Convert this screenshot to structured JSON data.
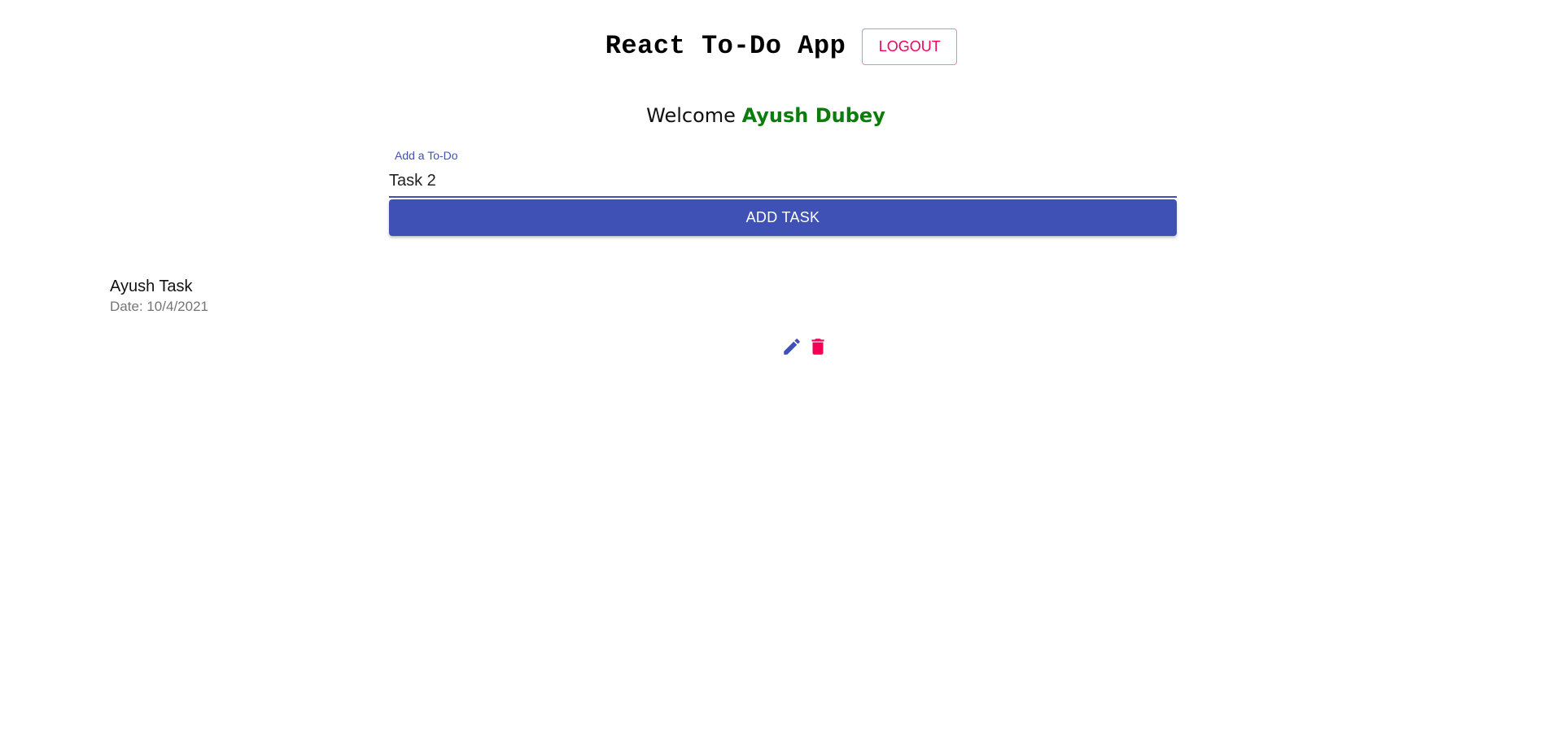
{
  "header": {
    "title": "React To-Do App",
    "logout_label": "LOGOUT"
  },
  "welcome": {
    "prefix": "Welcome",
    "user_name": "Ayush Dubey"
  },
  "form": {
    "input_label": "Add a To-Do",
    "input_value": "Task 2",
    "add_button_label": "ADD TASK"
  },
  "tasks": [
    {
      "title": "Ayush Task",
      "date": "Date: 10/4/2021",
      "actions": [
        {
          "icon": "pencil-icon",
          "color": "#3f51b5"
        },
        {
          "icon": "trash-icon",
          "color": "#f50057"
        }
      ]
    }
  ],
  "colors": {
    "primary": "#3f51b5",
    "secondary": "#f50057",
    "user_name": "#0a7d0a"
  }
}
